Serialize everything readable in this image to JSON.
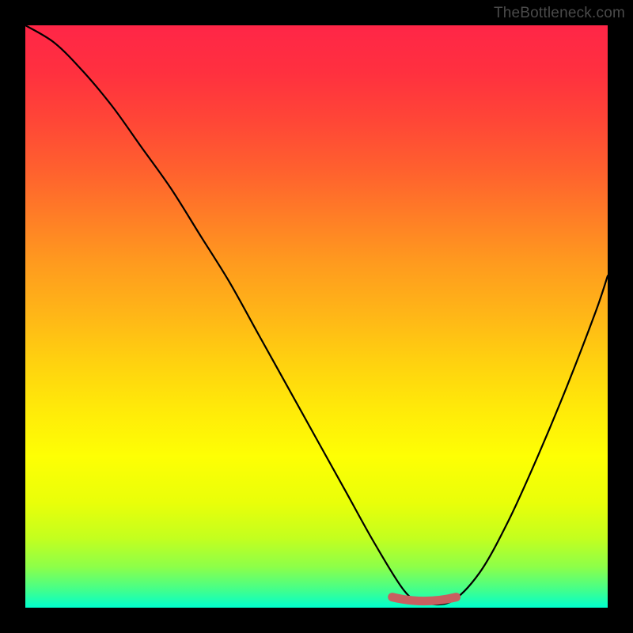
{
  "watermark": "TheBottleneck.com",
  "colors": {
    "background": "#000000",
    "curve": "#000000",
    "marker": "#c86060",
    "gradient_top": "#ff2647",
    "gradient_mid": "#ffea09",
    "gradient_bottom": "#00ffce"
  },
  "chart_data": {
    "type": "line",
    "title": "",
    "xlabel": "",
    "ylabel": "",
    "xlim": [
      0,
      100
    ],
    "ylim": [
      0,
      100
    ],
    "grid": false,
    "legend": false,
    "series": [
      {
        "name": "bottleneck-curve",
        "x": [
          0,
          5,
          10,
          15,
          20,
          25,
          30,
          35,
          40,
          45,
          50,
          55,
          60,
          65,
          68,
          73,
          78,
          83,
          88,
          93,
          98,
          100
        ],
        "values": [
          100,
          97,
          92,
          86,
          79,
          72,
          64,
          56,
          47,
          38,
          29,
          20,
          11,
          3,
          1,
          1,
          6,
          15,
          26,
          38,
          51,
          57
        ]
      }
    ],
    "annotations": [
      {
        "name": "optimal-range",
        "x_start": 63,
        "x_end": 74,
        "y": 1,
        "color": "#c86060"
      }
    ]
  }
}
